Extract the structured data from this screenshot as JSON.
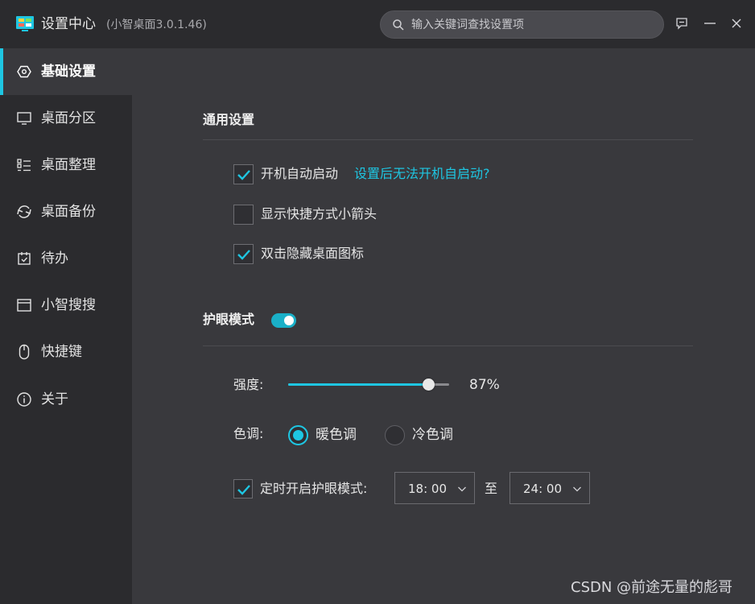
{
  "window": {
    "title": "设置中心",
    "version": "(小智桌面3.0.1.46)",
    "search_placeholder": "输入关键词查找设置项",
    "icons": [
      "app-logo",
      "search-icon",
      "feedback-icon",
      "minimize-icon",
      "close-icon"
    ]
  },
  "sidebar": {
    "items": [
      {
        "label": "基础设置",
        "icon": "hexagon-settings-icon",
        "active": true
      },
      {
        "label": "桌面分区",
        "icon": "monitor-icon",
        "active": false
      },
      {
        "label": "桌面整理",
        "icon": "list-icon",
        "active": false
      },
      {
        "label": "桌面备份",
        "icon": "sync-icon",
        "active": false
      },
      {
        "label": "待办",
        "icon": "calendar-check-icon",
        "active": false
      },
      {
        "label": "小智搜搜",
        "icon": "window-icon",
        "active": false
      },
      {
        "label": "快捷键",
        "icon": "mouse-icon",
        "active": false
      },
      {
        "label": "关于",
        "icon": "info-icon",
        "active": false
      }
    ]
  },
  "general": {
    "title": "通用设置",
    "options": [
      {
        "label": "开机自动启动",
        "checked": true
      },
      {
        "label": "显示快捷方式小箭头",
        "checked": false
      },
      {
        "label": "双击隐藏桌面图标",
        "checked": true
      }
    ],
    "help_link": "设置后无法开机自启动?"
  },
  "eye_care": {
    "title": "护眼模式",
    "enabled": true,
    "strength_label": "强度:",
    "strength_value": "87%",
    "strength_fraction": 0.87,
    "tone_label": "色调:",
    "tones": [
      {
        "label": "暖色调",
        "selected": true
      },
      {
        "label": "冷色调",
        "selected": false
      }
    ],
    "schedule_label": "定时开启护眼模式:",
    "schedule_enabled": true,
    "start_time": "18: 00",
    "to_label": "至",
    "end_time": "24: 00"
  },
  "watermark": "CSDN @前途无量的彪哥",
  "colors": {
    "accent": "#1ec6e2",
    "sidebar_bg": "#2b2b2e",
    "content_bg": "#39393d"
  }
}
